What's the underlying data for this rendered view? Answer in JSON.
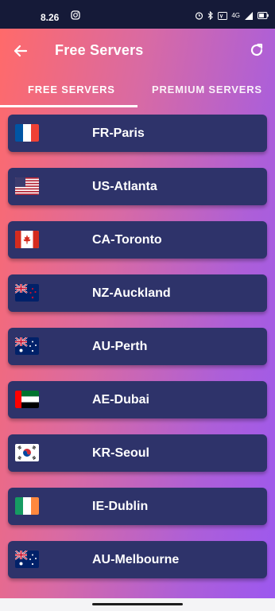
{
  "status_bar": {
    "time": "8.26",
    "network": "4G"
  },
  "app_bar": {
    "title": "Free Servers",
    "back_icon": "arrow-left-icon",
    "refresh_icon": "refresh-icon"
  },
  "tabs": [
    {
      "label": "FREE SERVERS",
      "selected": true
    },
    {
      "label": "PREMIUM SERVERS",
      "selected": false
    }
  ],
  "servers": [
    {
      "label": "FR-Paris",
      "flag": "flag-france-icon"
    },
    {
      "label": "US-Atlanta",
      "flag": "flag-usa-icon"
    },
    {
      "label": "CA-Toronto",
      "flag": "flag-canada-icon"
    },
    {
      "label": "NZ-Auckland",
      "flag": "flag-new-zealand-icon"
    },
    {
      "label": "AU-Perth",
      "flag": "flag-australia-icon"
    },
    {
      "label": "AE-Dubai",
      "flag": "flag-uae-icon"
    },
    {
      "label": "KR-Seoul",
      "flag": "flag-south-korea-icon"
    },
    {
      "label": "IE-Dublin",
      "flag": "flag-ireland-icon"
    },
    {
      "label": "AU-Melbourne",
      "flag": "flag-australia-icon"
    }
  ],
  "colors": {
    "status_bar": "#151a38",
    "gradient_start": "#ff6a6a",
    "gradient_end": "#9c58ef",
    "row_background": "#2e336a"
  }
}
